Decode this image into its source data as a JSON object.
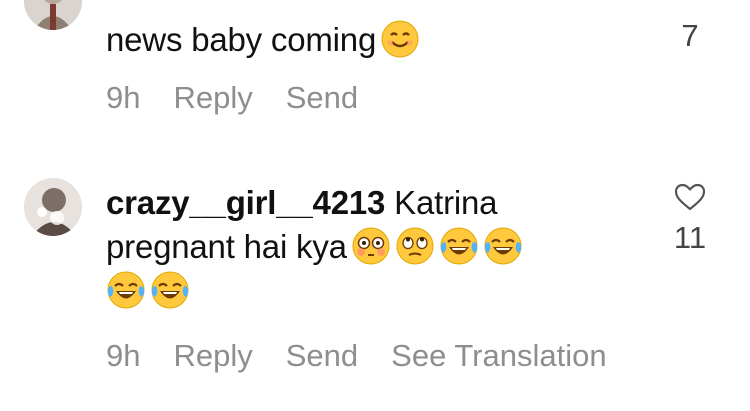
{
  "comments": [
    {
      "username": "",
      "text": "news baby coming",
      "emojis": [
        "smiling-face"
      ],
      "time": "9h",
      "actions": [
        "Reply",
        "Send"
      ],
      "like_count": "7"
    },
    {
      "username": "crazy__girl__4213",
      "text": " Katrina pregnant hai kya",
      "emojis": [
        "flushed-face",
        "eye-roll-face",
        "tears-of-joy-face",
        "tears-of-joy-face",
        "tears-of-joy-face",
        "tears-of-joy-face"
      ],
      "time": "9h",
      "actions": [
        "Reply",
        "Send",
        "See Translation"
      ],
      "like_count": "11"
    }
  ],
  "colors": {
    "text": "#111111",
    "meta": "#8e8e8e",
    "emoji_yellow": "#ffc83d"
  }
}
